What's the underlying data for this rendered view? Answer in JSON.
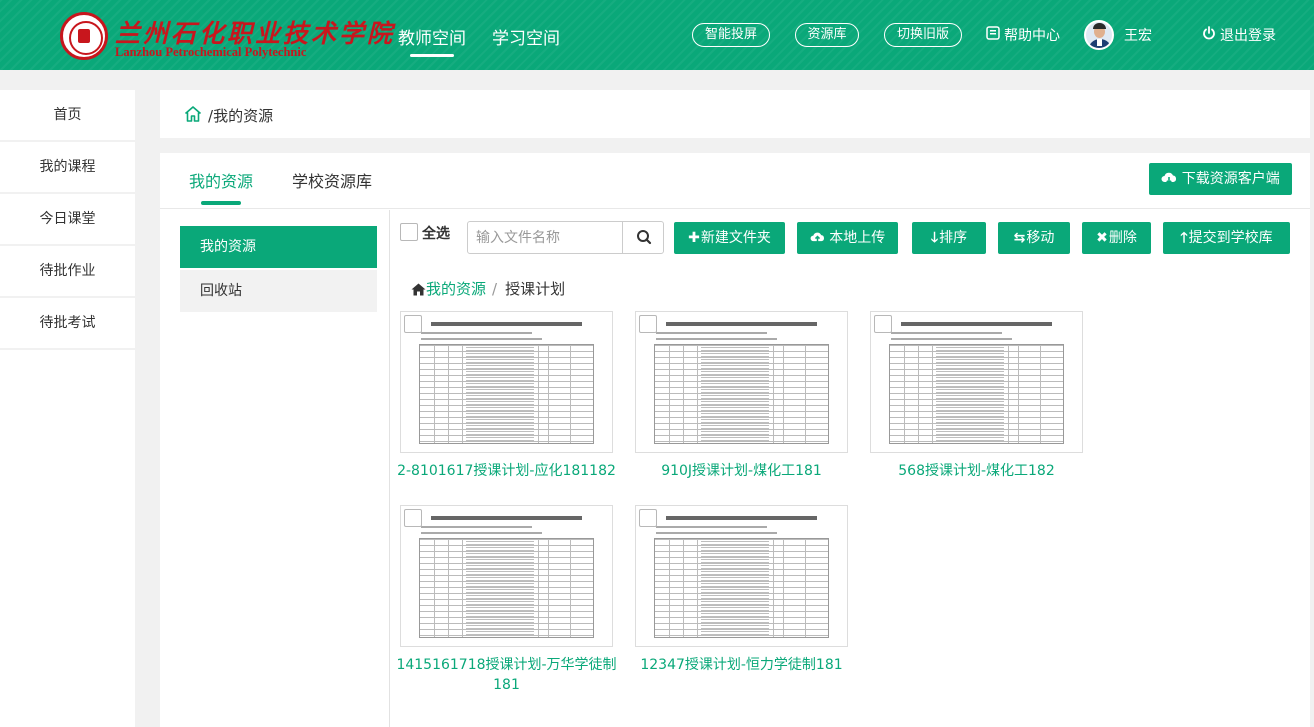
{
  "header": {
    "logo_cn": "兰州石化职业技术学院",
    "logo_en": "Lanzhou Petrochemical Polytechnic",
    "nav": [
      "教师空间",
      "学习空间"
    ],
    "pills": [
      "智能投屏",
      "资源库",
      "切换旧版"
    ],
    "help": "帮助中心",
    "user": "王宏",
    "logout": "退出登录"
  },
  "sidebar": {
    "items": [
      "首页",
      "我的课程",
      "今日课堂",
      "待批作业",
      "待批考试"
    ]
  },
  "breadcrumb": {
    "sep": "/",
    "current": "我的资源"
  },
  "tabs": [
    "我的资源",
    "学校资源库"
  ],
  "download_client": "下载资源客户端",
  "subnav": [
    "我的资源",
    "回收站"
  ],
  "toolbar": {
    "select_all": "全选",
    "search_placeholder": "输入文件名称",
    "buttons": [
      "新建文件夹",
      "本地上传",
      "排序",
      "移动",
      "删除",
      "提交到学校库"
    ]
  },
  "path": {
    "root": "我的资源",
    "sep": "/",
    "current": "授课计划"
  },
  "files": [
    {
      "name": "2-8101617授课计划-应化181182"
    },
    {
      "name": "910J授课计划-煤化工181"
    },
    {
      "name": "568授课计划-煤化工182"
    },
    {
      "name": "1415161718授课计划-万华学徒制181"
    },
    {
      "name": "12347授课计划-恒力学徒制181"
    }
  ],
  "colors": {
    "accent": "#0aa879",
    "logo_red": "#c8161d"
  }
}
